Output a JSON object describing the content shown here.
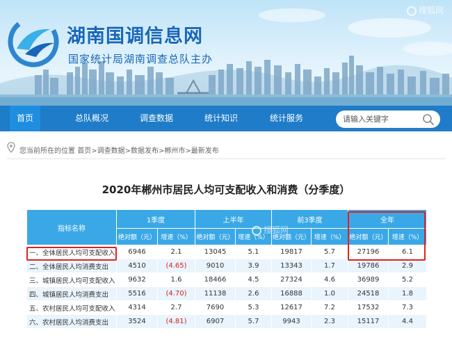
{
  "site": {
    "title": "湖南国调信息网",
    "subtitle": "国家统计局湖南调查总队主办",
    "watermark": "搜狐网",
    "colors": {
      "primary": "#1f7cc8",
      "header_blue": "#3aa8e6",
      "highlight_red": "#e02020",
      "negative_red": "#d42020"
    }
  },
  "nav": {
    "items": [
      {
        "label": "首页",
        "active": true
      },
      {
        "label": "总队概况",
        "active": false
      },
      {
        "label": "调查数据",
        "active": false
      },
      {
        "label": "统计知识",
        "active": false
      },
      {
        "label": "统计服务",
        "active": false
      }
    ],
    "search": {
      "placeholder": "请输入关键字",
      "icon": "search-icon"
    }
  },
  "breadcrumb": {
    "prefix": "您当前所在的位置",
    "items": [
      "首页",
      "调查数据",
      "数据发布",
      "郴州市",
      "最新发布"
    ],
    "separator": ">",
    "icon": "location-pin-icon"
  },
  "page_title": "2020年郴州市居民人均可支配收入和消费（分季度）",
  "table": {
    "indicator_header": "指标名称",
    "periods": [
      "1季度",
      "上半年",
      "前3季度",
      "全年"
    ],
    "sub_headers": {
      "absolute": "绝对额（元）",
      "growth": "增速（%）"
    },
    "rows": [
      {
        "name": "一、全体居民人均可支配收入",
        "values": [
          "6946",
          "2.1",
          "13045",
          "5.1",
          "19817",
          "5.7",
          "27196",
          "6.1"
        ]
      },
      {
        "name": "二、全体居民人均消费支出",
        "values": [
          "4510",
          "(4.65)",
          "9010",
          "3.9",
          "13343",
          "1.7",
          "19786",
          "2.9"
        ]
      },
      {
        "name": "三、城镇居民人均可支配收入",
        "values": [
          "9632",
          "1.6",
          "18466",
          "4.5",
          "27324",
          "4.6",
          "36989",
          "5.2"
        ]
      },
      {
        "name": "四、城镇居民人均消费支出",
        "values": [
          "5516",
          "(4.70)",
          "11138",
          "2.6",
          "16888",
          "1.0",
          "24518",
          "1.8"
        ]
      },
      {
        "name": "五、农村居民人均可支配收入",
        "values": [
          "4314",
          "2.7",
          "7690",
          "5.3",
          "12617",
          "7.2",
          "17532",
          "7.3"
        ]
      },
      {
        "name": "六、农村居民人均消费支出",
        "values": [
          "3524",
          "(4.81)",
          "6907",
          "5.7",
          "9943",
          "2.3",
          "15117",
          "4.4"
        ]
      }
    ]
  }
}
